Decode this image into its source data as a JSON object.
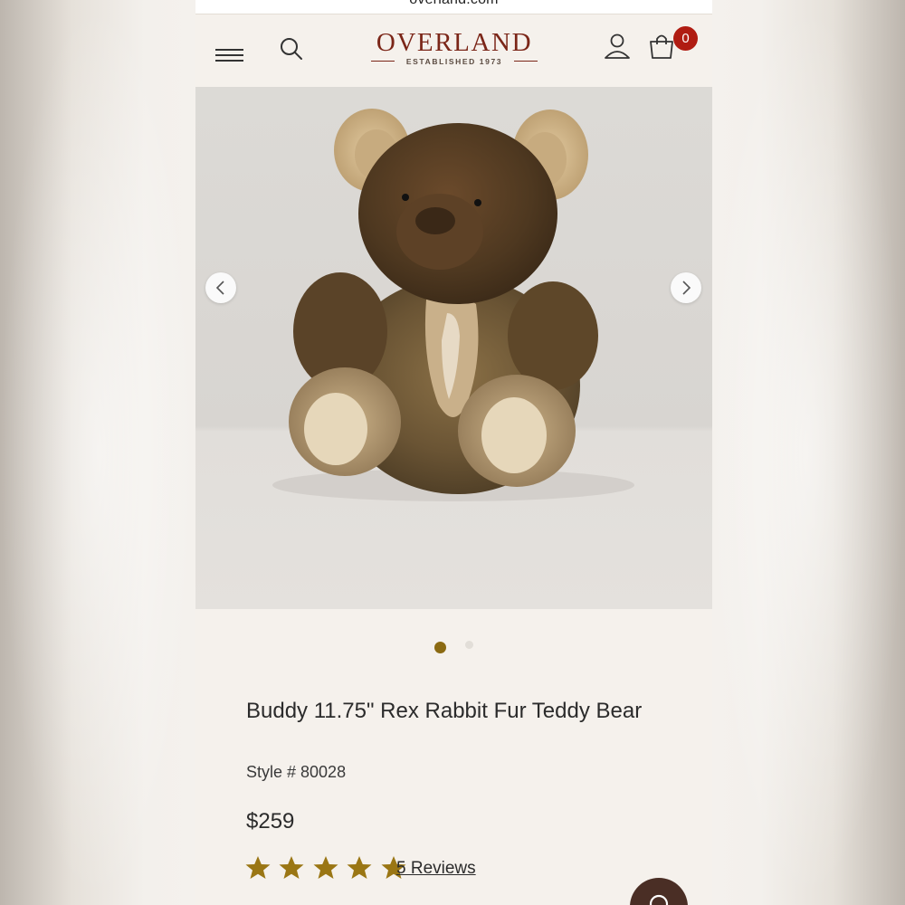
{
  "browser": {
    "url": "overland.com"
  },
  "header": {
    "logo_title": "OVERLAND",
    "logo_subtitle": "ESTABLISHED 1973",
    "cart_count": "0"
  },
  "gallery": {
    "image_subject": "brown rex rabbit fur teddy bear",
    "slide_count": 2,
    "active_slide": 1
  },
  "product": {
    "title": "Buddy 11.75\" Rex Rabbit Fur Teddy Bear",
    "style": "Style # 80028",
    "price": "$259",
    "rating_stars": 5,
    "reviews_label": "5 Reviews"
  },
  "colors": {
    "brand": "#7b2618",
    "accent_gold": "#8b6a12",
    "badge_red": "#b01c12",
    "page_bg": "#f5f1ec",
    "chat_button": "#4a2e25"
  },
  "icons": [
    "hamburger-menu-icon",
    "search-icon",
    "account-icon",
    "cart-icon",
    "chevron-left-icon",
    "chevron-right-icon",
    "star-icon",
    "chat-icon"
  ]
}
